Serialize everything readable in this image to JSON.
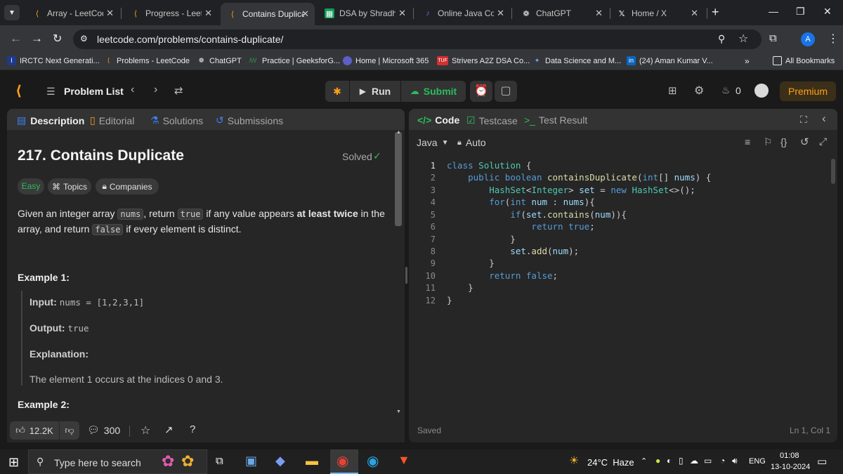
{
  "browser": {
    "tabs": [
      {
        "title": "Array - LeetCode",
        "icon": "leetcode-icon"
      },
      {
        "title": "Progress - LeetCode",
        "icon": "leetcode-icon"
      },
      {
        "title": "Contains Duplicate",
        "icon": "leetcode-icon",
        "active": true
      },
      {
        "title": "DSA by Shradha",
        "icon": "sheets-icon"
      },
      {
        "title": "Online Java Compiler",
        "icon": "compiler-icon"
      },
      {
        "title": "ChatGPT",
        "icon": "chatgpt-icon"
      },
      {
        "title": "Home / X",
        "icon": "x-icon"
      }
    ],
    "url": "leetcode.com/problems/contains-duplicate/",
    "profile_initial": "A",
    "bookmarks": [
      "IRCTC Next Generati...",
      "Problems - LeetCode",
      "ChatGPT",
      "Practice | GeeksforG...",
      "Home | Microsoft 365",
      "Strivers A2Z DSA Co...",
      "Data Science and M...",
      "(24) Aman Kumar V..."
    ],
    "all_bookmarks": "All Bookmarks"
  },
  "header": {
    "problem_list": "Problem List",
    "run": "Run",
    "submit": "Submit",
    "streak": "0",
    "premium": "Premium"
  },
  "left": {
    "tabs": [
      "Description",
      "Editorial",
      "Solutions",
      "Submissions"
    ],
    "title": "217. Contains Duplicate",
    "solved": "Solved",
    "difficulty": "Easy",
    "topics": "Topics",
    "companies": "Companies",
    "desc": {
      "p1": "Given an integer array",
      "c1": "nums",
      "p2": ", return",
      "c2": "true",
      "p3": "if any value appears",
      "b1": "at least twice",
      "p4": "in the",
      "p5": "array, and return",
      "c3": "false",
      "p6": "if every element is distinct."
    },
    "example1_title": "Example 1:",
    "input_label": "Input:",
    "input_value": "nums = [1,2,3,1]",
    "output_label": "Output:",
    "output_value": "true",
    "explanation_label": "Explanation:",
    "explanation_text": "The element 1 occurs at the indices 0 and 3.",
    "example2_title": "Example 2:",
    "likes": "12.2K",
    "comments": "300"
  },
  "right": {
    "tabs": [
      "Code",
      "Testcase",
      "Test Result"
    ],
    "language": "Java",
    "mode": "Auto",
    "status": "Saved",
    "cursor": "Ln 1, Col 1",
    "line_numbers": [
      "1",
      "2",
      "3",
      "4",
      "5",
      "6",
      "7",
      "8",
      "9",
      "10",
      "11",
      "12"
    ]
  },
  "taskbar": {
    "search_placeholder": "Type here to search",
    "weather": "24°C  Haze",
    "lang": "ENG",
    "time": "01:08",
    "date": "13-10-2024"
  }
}
